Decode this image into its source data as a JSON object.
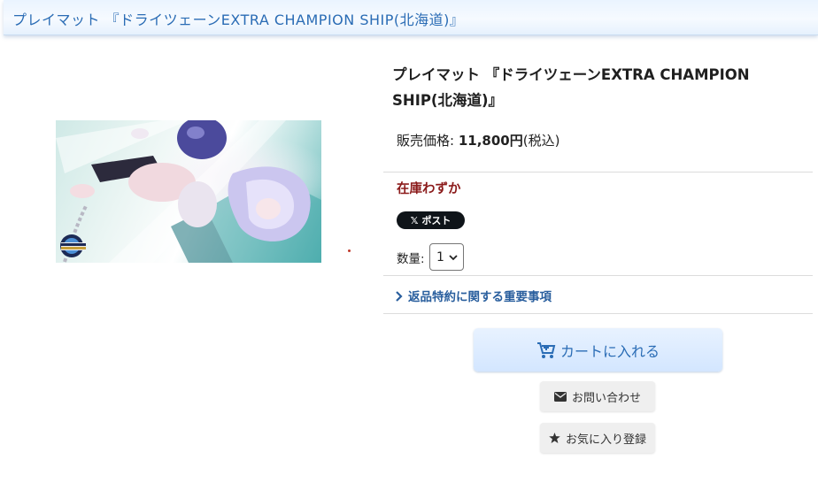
{
  "header": {
    "title": "プレイマット 『ドライツェーンEXTRA CHAMPION SHIP(北海道)』"
  },
  "product": {
    "title": "プレイマット 『ドライツェーンEXTRA CHAMPION SHIP(北海道)』",
    "image_alt_logo_text": "EXTRA CHAMPIONSHIP",
    "price_label": "販売価格: ",
    "price_value": "11,800円",
    "tax_note": "(税込)",
    "stock_status": "在庫わずか",
    "share_button": "ポスト",
    "share_logo": "𝕏",
    "quantity_label": "数量:",
    "quantity_value": "1",
    "returns_link": "返品特約に関する重要事項"
  },
  "actions": {
    "add_to_cart": "カートに入れる",
    "inquiry": "お問い合わせ",
    "favorite": "お気に入り登録"
  },
  "icons": {
    "cart": "cart-plus-icon",
    "envelope": "envelope-icon",
    "star": "star-icon",
    "chevron": "chevron-right-icon",
    "select": "chevron-down-icon"
  },
  "colors": {
    "accent": "#2a6cb5",
    "stock": "#8b1a1a",
    "cart_bg": "#d3e6ff"
  }
}
